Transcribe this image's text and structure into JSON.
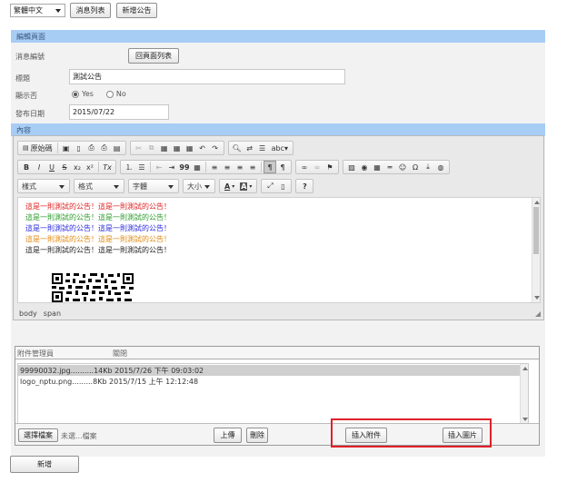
{
  "top": {
    "language": "繁體中文",
    "news_list": "消息列表",
    "add_announcement": "新增公告"
  },
  "section_edit": "編輯頁面",
  "form": {
    "news_id_label": "消息編號",
    "back_to_list": "回頁面列表",
    "title_label": "標題",
    "title_value": "測試公告",
    "display_label": "顯示否",
    "yes": "Yes",
    "no": "No",
    "date_label": "發布日期",
    "date_value": "2015/07/22"
  },
  "section_content": "內容",
  "toolbar": {
    "source": "原始碼",
    "bold": "B",
    "italic": "I",
    "underline": "U",
    "strike": "S",
    "subscript": "x₂",
    "superscript": "x²",
    "remove_format": "Tx",
    "styles": "樣式",
    "format": "格式",
    "font": "字體",
    "size": "大小",
    "text_color": "A",
    "bg_color": "A",
    "help": "?",
    "omega": "Ω",
    "quote": "99"
  },
  "editor": {
    "lines": [
      {
        "text": "這是一則測試的公告！這是一則測試的公告！",
        "color": "#e02020"
      },
      {
        "text": "這是一則測試的公告！這是一則測試的公告！",
        "color": "#2a9a2a"
      },
      {
        "text": "這是一則測試的公告！這是一則測試的公告！",
        "color": "#2a2adf"
      },
      {
        "text": "這是一則測試的公告！這是一則測試的公告！",
        "color": "#e08a10"
      },
      {
        "text": "這是一則測試的公告！這是一則測試的公告！",
        "color": "#222222"
      }
    ],
    "path": [
      "body",
      "span"
    ]
  },
  "attachments": {
    "title": "附件管理員",
    "close": "關閉",
    "files": [
      {
        "text": "99990032.jpg..........14Kb      2015/7/26 下午 09:03:02",
        "selected": true
      },
      {
        "text": "logo_nptu.png.........8Kb      2015/7/15 上午 12:12:48",
        "selected": false
      }
    ],
    "choose_file": "選擇檔案",
    "no_file": "未選...檔案",
    "upload": "上傳",
    "delete": "刪除",
    "insert_attachment": "插入附件",
    "insert_image": "插入圖片"
  },
  "bottom": {
    "add": "新增"
  },
  "colors": {
    "section_bar": "#a8cdf5",
    "highlight": "#e0202a"
  }
}
